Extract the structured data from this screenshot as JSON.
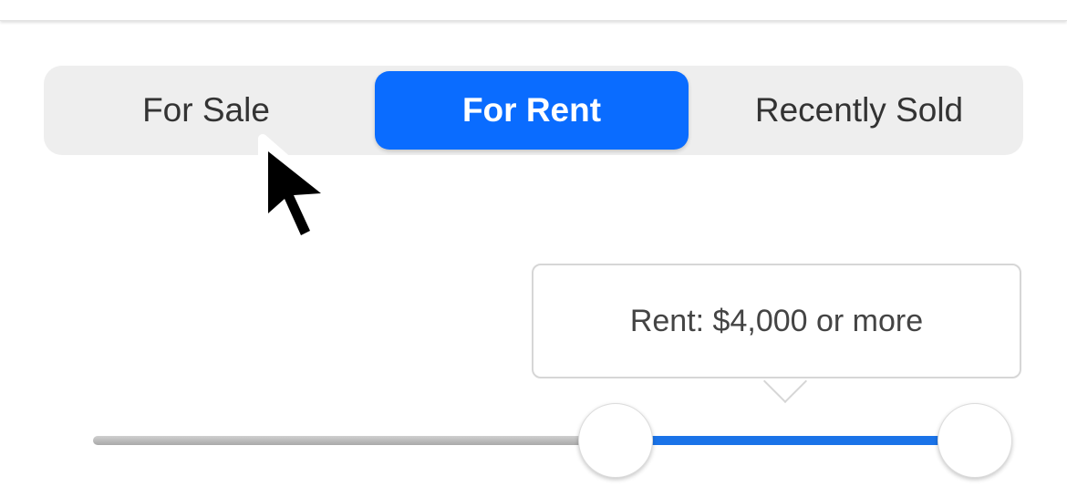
{
  "tabs": {
    "items": [
      {
        "label": "For Sale",
        "selected": false
      },
      {
        "label": "For Rent",
        "selected": true
      },
      {
        "label": "Recently Sold",
        "selected": false
      }
    ]
  },
  "price_filter": {
    "tooltip_text": "Rent: $4,000 or more",
    "range_min_fraction": 0.58,
    "range_max_fraction": 1.0
  },
  "colors": {
    "accent": "#0a6cff",
    "track_fill": "#1a73e8"
  },
  "icons": {
    "cursor": "mouse-pointer-icon"
  }
}
